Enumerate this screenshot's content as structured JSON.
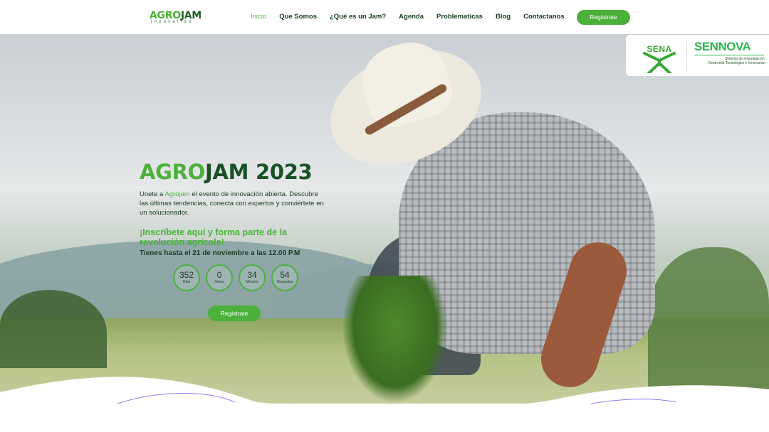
{
  "header": {
    "logo": {
      "agro": "AGRO",
      "jam": "JAM",
      "sub": "innovation"
    },
    "nav": [
      {
        "label": "Inicio",
        "active": true
      },
      {
        "label": "Que Somos",
        "active": false
      },
      {
        "label": "¿Qué es un Jam?",
        "active": false
      },
      {
        "label": "Agenda",
        "active": false
      },
      {
        "label": "Problematicas",
        "active": false
      },
      {
        "label": "Blog",
        "active": false
      },
      {
        "label": "Contactanos",
        "active": false
      }
    ],
    "register_button": "Registrate"
  },
  "partner": {
    "sena": "SENA",
    "sennova": "SENNOVA",
    "sennova_desc_1": "Sistema de Investigación,",
    "sennova_desc_2": "Desarrollo Tecnológico e Innovación"
  },
  "hero": {
    "title_a": "AGRO",
    "title_b": "JAM 2023",
    "desc_1": "Unete a ",
    "desc_hl": "Agrojam",
    "desc_2": " el evento de innovación abierta. Descubre las últimas tendencias, conecta con expertos y conviértete en un solucionador.",
    "subtitle": "¡Inscríbete aquí y forma parte de la revolución agrícola!",
    "deadline": "Tienes hasta el 21 de noviembre a las 12.00 P.M",
    "countdown": [
      {
        "value": "352",
        "label": "Días"
      },
      {
        "value": "0",
        "label": "Horas"
      },
      {
        "value": "34",
        "label": "Minutos"
      },
      {
        "value": "54",
        "label": "Segundos"
      }
    ],
    "register_button": "Registrate"
  },
  "colors": {
    "brand_green": "#4bb13b",
    "dark_green": "#1a5224",
    "wave_accent": "#8b7ef0"
  }
}
